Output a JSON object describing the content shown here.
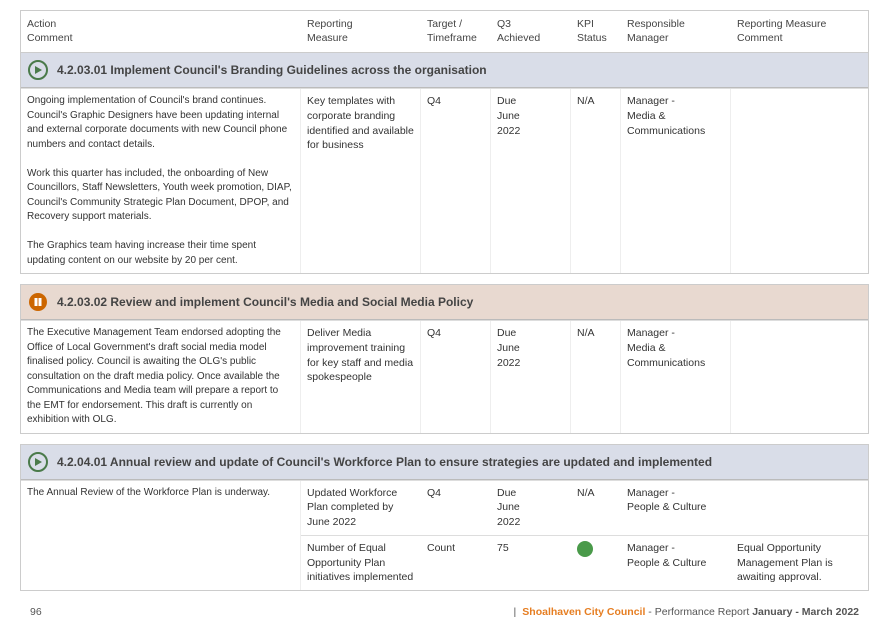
{
  "header": {
    "columns": [
      {
        "id": "action",
        "label": "Action\nComment"
      },
      {
        "id": "reporting",
        "label": "Reporting\nMeasure"
      },
      {
        "id": "target",
        "label": "Target /\nTimeframe"
      },
      {
        "id": "q3",
        "label": "Q3\nAchieved"
      },
      {
        "id": "kpi",
        "label": "KPI\nStatus"
      },
      {
        "id": "manager",
        "label": "Responsible\nManager"
      },
      {
        "id": "comment",
        "label": "Reporting Measure\nComment"
      }
    ]
  },
  "sections": [
    {
      "id": "4.2.03.01",
      "icon_type": "green_arrow",
      "title": "4.2.03.01 Implement Council's Branding Guidelines across the organisation",
      "rows": [
        {
          "action": "Ongoing implementation of Council's brand continues. Council's Graphic Designers have been updating internal and external corporate documents with new Council phone numbers and contact details.\nWork this quarter has included, the onboarding of New Councillors, Staff Newsletters, Youth week promotion, DIAP, Council's Community Strategic Plan Document, DPOP, and Recovery support materials.\nThe Graphics team having increase their time spent updating content on our website by 20 per cent.",
          "measure": "Key templates with corporate branding identified and available for business",
          "target": "Q4",
          "achieved": "Due\nJune\n2022",
          "kpi_status": "N/A",
          "manager": "Manager -\nMedia &\nCommunications",
          "comment": ""
        }
      ]
    },
    {
      "id": "4.2.03.02",
      "icon_type": "orange_pause",
      "title": "4.2.03.02 Review and implement Council's Media and Social Media Policy",
      "rows": [
        {
          "action": "The Executive Management Team endorsed adopting the Office of Local Government's draft social media model finalised policy. Council is awaiting the OLG's public consultation on the draft media policy. Once available the Communications and Media team will prepare a report to the EMT for endorsement. This draft is currently on exhibition with OLG.",
          "measure": "Deliver Media improvement training for key staff and media spokespeople",
          "target": "Q4",
          "achieved": "Due\nJune\n2022",
          "kpi_status": "N/A",
          "manager": "Manager -\nMedia &\nCommunications",
          "comment": ""
        }
      ]
    },
    {
      "id": "4.2.04.01",
      "icon_type": "green_arrow",
      "title": "4.2.04.01 Annual review and update of Council's Workforce Plan to ensure strategies are updated and implemented",
      "rows": [
        {
          "action": "The Annual Review of the Workforce Plan is underway.",
          "sub_rows": [
            {
              "measure": "Updated Workforce Plan completed by June 2022",
              "target": "Q4",
              "achieved": "Due\nJune\n2022",
              "kpi_status": "N/A",
              "kpi_dot": "",
              "manager": "Manager -\nPeople & Culture",
              "comment": ""
            },
            {
              "measure": "Number of Equal Opportunity Plan initiatives implemented",
              "target": "Count",
              "achieved": "75",
              "kpi_status": "green_dot",
              "kpi_dot": "green",
              "manager": "Manager -\nPeople & Culture",
              "comment": "Equal Opportunity Management Plan is awaiting approval."
            }
          ]
        }
      ]
    }
  ],
  "footer": {
    "page_number": "96",
    "separator": "|",
    "council_name": "Shoalhaven City Council",
    "report_label": " - Performance Report ",
    "date_range": "January - March 2022"
  }
}
